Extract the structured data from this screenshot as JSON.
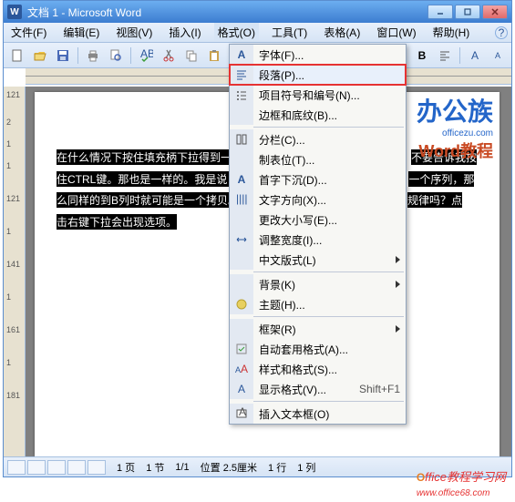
{
  "window_title": "文档 1 - Microsoft Word",
  "menubar": {
    "file": "文件(F)",
    "edit": "编辑(E)",
    "view": "视图(V)",
    "insert": "插入(I)",
    "format": "格式(O)",
    "tools": "工具(T)",
    "table": "表格(A)",
    "window": "窗口(W)",
    "help": "帮助(H)"
  },
  "format_menu": {
    "font": "字体(F)...",
    "paragraph": "段落(P)...",
    "bullets": "项目符号和编号(N)...",
    "borders": "边框和底纹(B)...",
    "columns": "分栏(C)...",
    "tabs": "制表位(T)...",
    "dropcap": "首字下沉(D)...",
    "textdir": "文字方向(X)...",
    "changecase": "更改大小写(E)...",
    "fitwidth": "调整宽度(I)...",
    "asianlayout": "中文版式(L)",
    "background": "背景(K)",
    "theme": "主题(H)...",
    "frame": "框架(R)",
    "autoformat": "自动套用格式(A)...",
    "styles": "样式和格式(S)...",
    "reveal": "显示格式(V)...",
    "reveal_shortcut": "Shift+F1",
    "textbox": "插入文本框(O)"
  },
  "document_text": {
    "line1": "在什么情况下按住填充柄下拉得到一",
    "line1b": "不要告诉我按",
    "line2": "住CTRL键。那也是一样的。我是说，",
    "line2b": "一个序列，那",
    "line3": "么同样的到B列时就可能是一个拷贝。",
    "line3b": "规律吗？点",
    "line4": "击右键下拉会出现选项。"
  },
  "statusbar": {
    "page": "1 页",
    "section": "1 节",
    "page_of": "1/1",
    "position": "位置 2.5厘米",
    "line_no": "1 行",
    "col_no": "1 列"
  },
  "watermark": {
    "brand": "办公族",
    "brand_url": "officezu.com",
    "brand_word": "Word教程",
    "site": "Office教程学习网",
    "site_url": "www.office68.com"
  },
  "ruler_v_ticks": [
    "121",
    "2",
    "1",
    "1",
    "121",
    "1",
    "141",
    "1",
    "161",
    "1",
    "181"
  ]
}
